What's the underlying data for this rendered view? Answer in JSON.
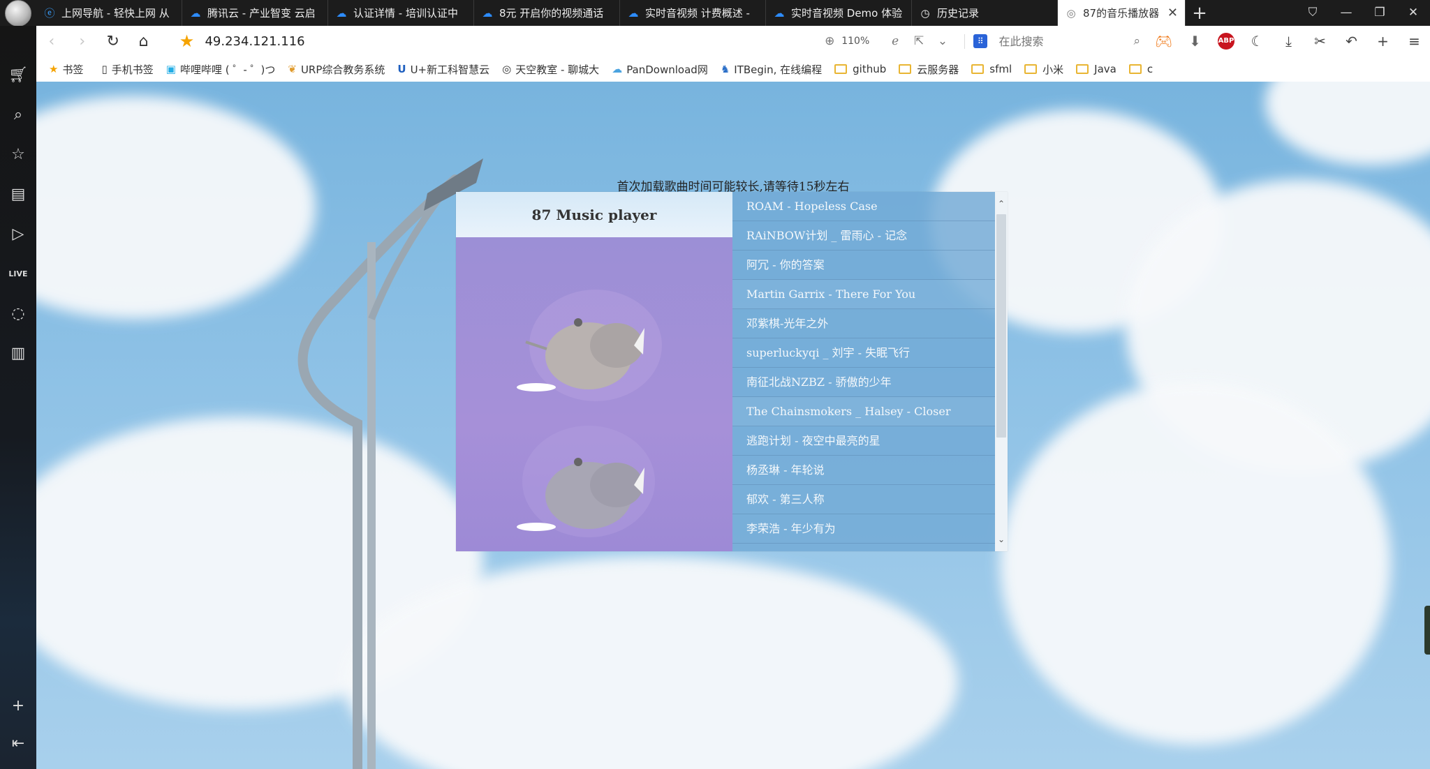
{
  "tabs": [
    {
      "label": "上网导航 - 轻快上网 从",
      "icon": "e-icon"
    },
    {
      "label": "腾讯云 - 产业智变 云启",
      "icon": "cloud-icon"
    },
    {
      "label": "认证详情 - 培训认证中",
      "icon": "cloud-icon"
    },
    {
      "label": "8元 开启你的视频通话",
      "icon": "cloud-icon"
    },
    {
      "label": "实时音视频 计费概述 -",
      "icon": "cloud-icon"
    },
    {
      "label": "实时音视频 Demo 体验",
      "icon": "cloud-icon"
    },
    {
      "label": "历史记录",
      "icon": "clock-icon"
    }
  ],
  "active_tab": {
    "label": "87的音乐播放器",
    "icon": "globe-icon"
  },
  "address": {
    "url": "49.234.121.116",
    "zoom": "110%"
  },
  "search": {
    "placeholder": "在此搜索"
  },
  "bookmarks": [
    {
      "label": "书签",
      "kind": "star"
    },
    {
      "label": "手机书签",
      "kind": "phone"
    },
    {
      "label": "哔哩哔哩 ( ゜- ゜)つ",
      "kind": "bili"
    },
    {
      "label": "URP综合教务系统",
      "kind": "leaf"
    },
    {
      "label": "U+新工科智慧云",
      "kind": "u"
    },
    {
      "label": "天空教室 - 聊城大",
      "kind": "globe"
    },
    {
      "label": "PanDownload网",
      "kind": "cloud"
    },
    {
      "label": "ITBegin, 在线编程",
      "kind": "person"
    },
    {
      "label": "github",
      "kind": "folder"
    },
    {
      "label": "云服务器",
      "kind": "folder"
    },
    {
      "label": "sfml",
      "kind": "folder"
    },
    {
      "label": "小米",
      "kind": "folder"
    },
    {
      "label": "Java",
      "kind": "folder"
    },
    {
      "label": "c",
      "kind": "folder"
    }
  ],
  "page": {
    "notice": "首次加载歌曲时间可能较长,请等待15秒左右",
    "player_title": "87 Music player",
    "playlist": [
      "ROAM - Hopeless Case",
      "RAiNBOW计划 _ 雷雨心 - 记念",
      "阿冗 - 你的答案",
      "Martin Garrix - There For You",
      "邓紫棋-光年之外",
      "superluckyqi _ 刘宇 - 失眠飞行",
      "南征北战NZBZ - 骄傲的少年",
      "The Chainsmokers _ Halsey - Closer",
      "逃跑计划 - 夜空中最亮的星",
      "杨丞琳 - 年轮说",
      "郁欢 - 第三人称",
      "李荣浩 - 年少有为"
    ]
  },
  "colors": {
    "accent_star": "#f5a300",
    "playlist_bg": "#72aad6",
    "cover_bg": "#9c8fd6"
  }
}
